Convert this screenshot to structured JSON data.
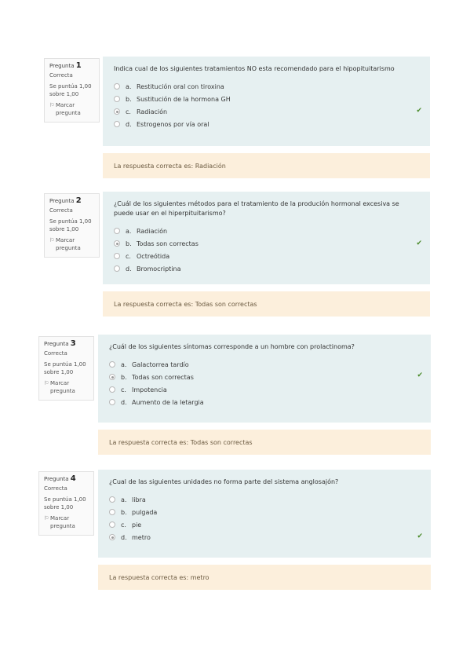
{
  "questions": [
    {
      "label": "Pregunta",
      "number": "1",
      "state": "Correcta",
      "grade": "Se puntúa 1,00 sobre 1,00",
      "flag": "Marcar pregunta",
      "text": "Indica cual de los siguientes tratamientos NO esta recomendado para el hipopituitarismo",
      "options": [
        {
          "letter": "a.",
          "text": "Restitución oral con tiroxina",
          "checked": false
        },
        {
          "letter": "b.",
          "text": "Sustitución de la hormona GH",
          "checked": false
        },
        {
          "letter": "c.",
          "text": "Radiación",
          "checked": true
        },
        {
          "letter": "d.",
          "text": "Estrogenos por vía oral",
          "checked": false
        }
      ],
      "feedback": "La respuesta correcta es: Radiación"
    },
    {
      "label": "Pregunta",
      "number": "2",
      "state": "Correcta",
      "grade": "Se puntúa 1,00 sobre 1,00",
      "flag": "Marcar pregunta",
      "text": "¿Cuál de los siguientes métodos para el tratamiento de la produción hormonal excesiva se puede usar en el hiperpituitarismo?",
      "options": [
        {
          "letter": "a.",
          "text": "Radiación",
          "checked": false
        },
        {
          "letter": "b.",
          "text": "Todas son correctas",
          "checked": true
        },
        {
          "letter": "c.",
          "text": "Octreótida",
          "checked": false
        },
        {
          "letter": "d.",
          "text": "Bromocriptina",
          "checked": false
        }
      ],
      "feedback": "La respuesta correcta es: Todas son correctas"
    },
    {
      "label": "Pregunta",
      "number": "3",
      "state": "Correcta",
      "grade": "Se puntúa 1,00 sobre 1,00",
      "flag": "Marcar pregunta",
      "text": "¿Cuál de los siguientes síntomas corresponde a un hombre con prolactinoma?",
      "options": [
        {
          "letter": "a.",
          "text": "Galactorrea tardío",
          "checked": false
        },
        {
          "letter": "b.",
          "text": "Todas son correctas",
          "checked": true
        },
        {
          "letter": "c.",
          "text": "Impotencia",
          "checked": false
        },
        {
          "letter": "d.",
          "text": "Aumento de la letargia",
          "checked": false
        }
      ],
      "feedback": "La respuesta correcta es: Todas son correctas"
    },
    {
      "label": "Pregunta",
      "number": "4",
      "state": "Correcta",
      "grade": "Se puntúa 1,00 sobre 1,00",
      "flag": "Marcar pregunta",
      "text": "¿Cual de las siguientes unidades no forma parte del sistema anglosajón?",
      "options": [
        {
          "letter": "a.",
          "text": "libra",
          "checked": false
        },
        {
          "letter": "b.",
          "text": "pulgada",
          "checked": false
        },
        {
          "letter": "c.",
          "text": "pie",
          "checked": false
        },
        {
          "letter": "d.",
          "text": "metro",
          "checked": true
        }
      ],
      "feedback": "La respuesta correcta es: metro"
    }
  ],
  "icons": {
    "correct": "check-icon",
    "flag": "flag-icon",
    "radio": "radio-icon"
  },
  "colors": {
    "correct": "#4a8a2a",
    "formulation_bg": "#e6f0f1",
    "feedback_bg": "#fcefdc"
  }
}
